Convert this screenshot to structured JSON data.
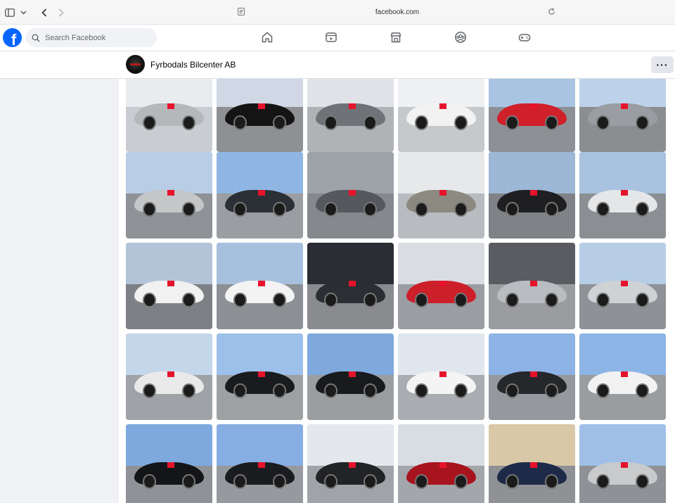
{
  "browser": {
    "url": "facebook.com"
  },
  "facebook": {
    "logo": "f",
    "search_placeholder": "Search Facebook",
    "nav_icons": [
      "home-icon",
      "video-icon",
      "marketplace-icon",
      "groups-icon",
      "gaming-icon"
    ]
  },
  "page": {
    "name": "Fyrbodals Bilcenter AB",
    "more_label": "···"
  },
  "colors": {
    "brand": "#0866ff",
    "sign": "#e6132b"
  }
}
